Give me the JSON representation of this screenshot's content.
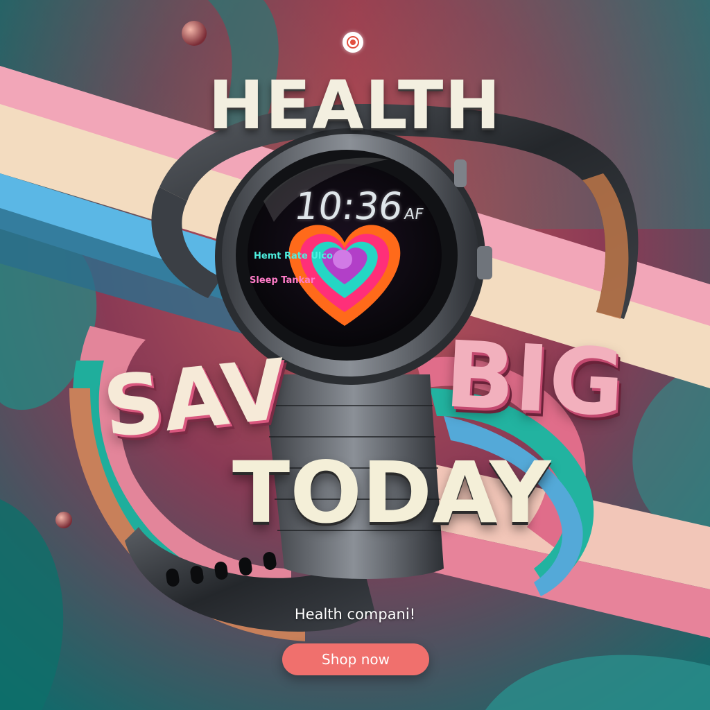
{
  "brand": {
    "logo_icon": "target-logo-icon",
    "accent_color": "#f0706d"
  },
  "headline": "HEALTH",
  "promo": {
    "save_text": "SAV",
    "big_text": "BIG",
    "today_text": "TODAY"
  },
  "watch_screen": {
    "time": "10:36",
    "time_suffix": "AF",
    "metric_label_1": "Hemt Rate Ulco",
    "metric_label_2": "Sleep Tankar",
    "graphic": "heart-icon"
  },
  "tagline": "Health compani!",
  "cta": {
    "label": "Shop now"
  }
}
